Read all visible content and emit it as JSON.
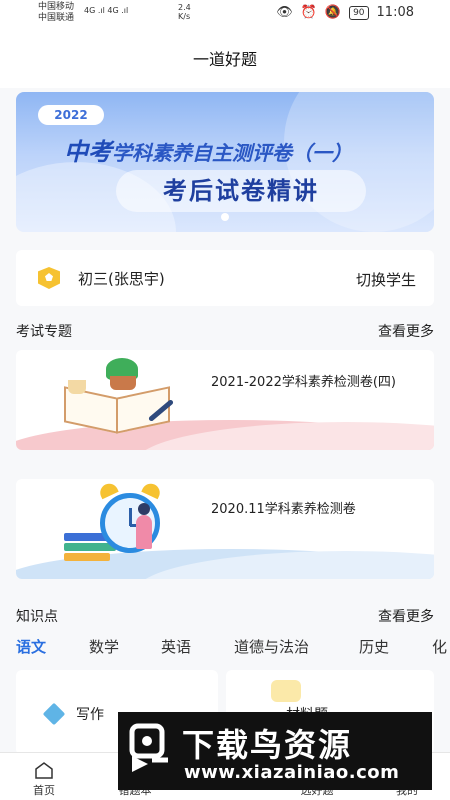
{
  "status_bar": {
    "carrier1": "中国移动",
    "carrier2": "中国联通",
    "signal_tags": "4G .ıl 4G .ıl",
    "net_speed_value": "2.4",
    "net_speed_unit": "K/s",
    "battery": "90",
    "time": "11:08"
  },
  "header": {
    "title": "一道好题"
  },
  "banner": {
    "year": "2022",
    "sub_highlight": "中考",
    "sub_text": "学科素养自主测评卷（一）",
    "main_text": "考后试卷精讲",
    "active_slide": 1,
    "slide_count": 1
  },
  "student": {
    "name": "初三(张思宇)",
    "switch_label": "切换学生",
    "badge_icon": "shield-badge-icon"
  },
  "exam_section": {
    "title": "考试专题",
    "more": "查看更多",
    "items": [
      {
        "label": "2021-2022学科素养检测卷(四)",
        "theme": "pink",
        "illustration": "book-plant-icon"
      },
      {
        "label": "2020.11学科素养检测卷",
        "theme": "blue",
        "illustration": "alarm-clock-icon"
      }
    ]
  },
  "knowledge_section": {
    "title": "知识点",
    "more": "查看更多",
    "tabs": [
      "语文",
      "数学",
      "英语",
      "道德与法治",
      "历史",
      "化"
    ],
    "active_tab": 0,
    "topics": [
      {
        "label": "写作",
        "icon": "cube-icon"
      },
      {
        "label": "材料题",
        "icon": "folder-icon"
      }
    ]
  },
  "bottom_nav": {
    "items": [
      {
        "label": "首页",
        "icon": "home-icon"
      },
      {
        "label": "错题本",
        "icon": "notebook-icon"
      },
      {
        "label": "选好题",
        "icon": "select-icon"
      },
      {
        "label": "我的",
        "icon": "user-icon"
      }
    ]
  },
  "watermark": {
    "text": "下载鸟资源",
    "url": "www.xiazainiao.com"
  },
  "colors": {
    "accent": "#2a6fe0",
    "banner_blue": "#8fb6f3",
    "badge_yellow": "#f6c231",
    "pink_wave": "#f7c9cd",
    "blue_wave": "#cfe3f7"
  }
}
